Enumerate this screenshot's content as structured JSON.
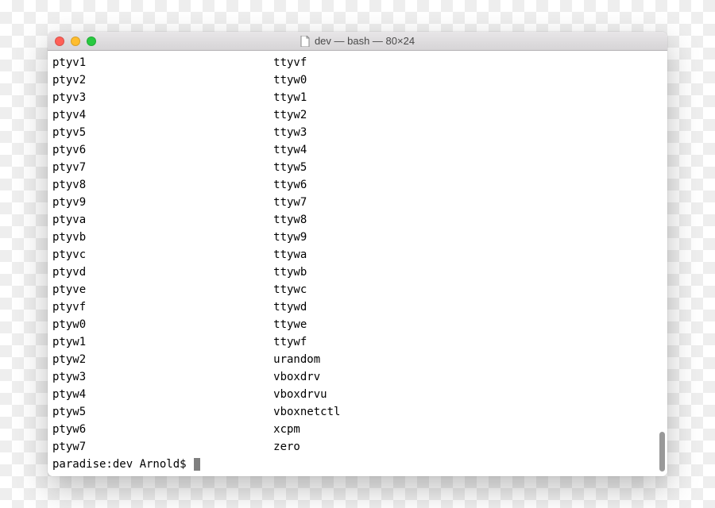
{
  "window": {
    "title": "dev — bash — 80×24"
  },
  "terminal": {
    "prompt": "paradise:dev Arnold$ ",
    "rows": [
      {
        "c1": "ptyv1",
        "c2": "ttyvf"
      },
      {
        "c1": "ptyv2",
        "c2": "ttyw0"
      },
      {
        "c1": "ptyv3",
        "c2": "ttyw1"
      },
      {
        "c1": "ptyv4",
        "c2": "ttyw2"
      },
      {
        "c1": "ptyv5",
        "c2": "ttyw3"
      },
      {
        "c1": "ptyv6",
        "c2": "ttyw4"
      },
      {
        "c1": "ptyv7",
        "c2": "ttyw5"
      },
      {
        "c1": "ptyv8",
        "c2": "ttyw6"
      },
      {
        "c1": "ptyv9",
        "c2": "ttyw7"
      },
      {
        "c1": "ptyva",
        "c2": "ttyw8"
      },
      {
        "c1": "ptyvb",
        "c2": "ttyw9"
      },
      {
        "c1": "ptyvc",
        "c2": "ttywa"
      },
      {
        "c1": "ptyvd",
        "c2": "ttywb"
      },
      {
        "c1": "ptyve",
        "c2": "ttywc"
      },
      {
        "c1": "ptyvf",
        "c2": "ttywd"
      },
      {
        "c1": "ptyw0",
        "c2": "ttywe"
      },
      {
        "c1": "ptyw1",
        "c2": "ttywf"
      },
      {
        "c1": "ptyw2",
        "c2": "urandom"
      },
      {
        "c1": "ptyw3",
        "c2": "vboxdrv"
      },
      {
        "c1": "ptyw4",
        "c2": "vboxdrvu"
      },
      {
        "c1": "ptyw5",
        "c2": "vboxnetctl"
      },
      {
        "c1": "ptyw6",
        "c2": "xcpm"
      },
      {
        "c1": "ptyw7",
        "c2": "zero"
      }
    ]
  }
}
